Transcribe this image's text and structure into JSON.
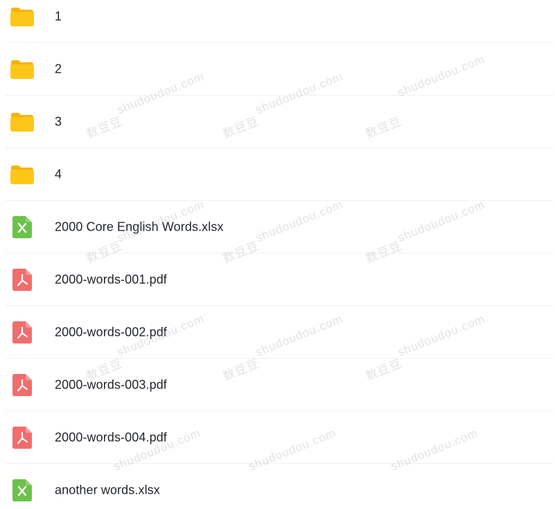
{
  "files": [
    {
      "name": "1",
      "icon": "folder-icon",
      "kind": "folder"
    },
    {
      "name": "2",
      "icon": "folder-icon",
      "kind": "folder"
    },
    {
      "name": "3",
      "icon": "folder-icon",
      "kind": "folder"
    },
    {
      "name": "4",
      "icon": "folder-icon",
      "kind": "folder"
    },
    {
      "name": "2000 Core English Words.xlsx",
      "icon": "excel-file-icon",
      "kind": "xlsx"
    },
    {
      "name": "2000-words-001.pdf",
      "icon": "pdf-file-icon",
      "kind": "pdf"
    },
    {
      "name": "2000-words-002.pdf",
      "icon": "pdf-file-icon",
      "kind": "pdf"
    },
    {
      "name": "2000-words-003.pdf",
      "icon": "pdf-file-icon",
      "kind": "pdf"
    },
    {
      "name": "2000-words-004.pdf",
      "icon": "pdf-file-icon",
      "kind": "pdf"
    },
    {
      "name": "another words.xlsx",
      "icon": "excel-file-icon",
      "kind": "xlsx"
    }
  ],
  "watermark": {
    "latin": "shudoudou.com",
    "cjk": "数豆豆"
  },
  "colors": {
    "folder": "#ffc61a",
    "folder_back": "#f5b400",
    "excel": "#6cc24a",
    "pdf": "#f16d6d",
    "text": "#1f2329",
    "divider": "#eef0f3"
  }
}
